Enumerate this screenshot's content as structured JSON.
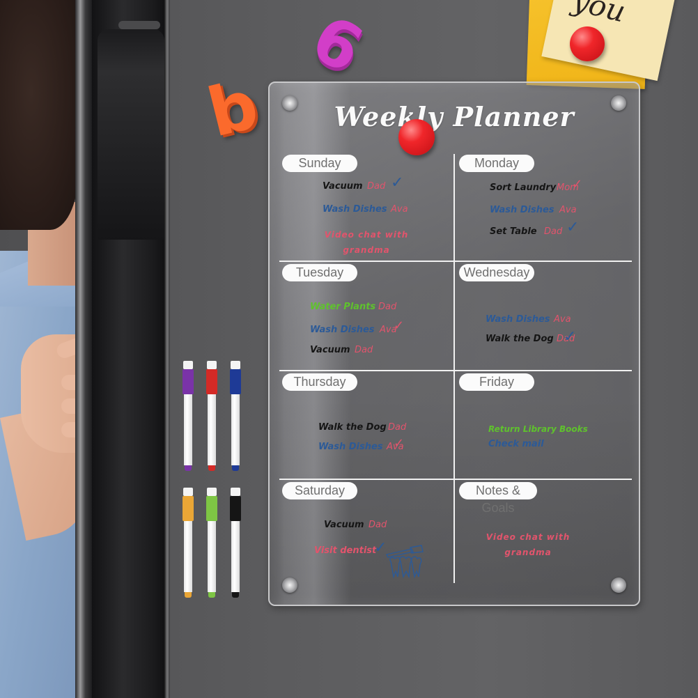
{
  "scene": {
    "description": "Acrylic weekly planner board mounted on a fridge door",
    "colors": {
      "fridge_gray": "#5f5f61",
      "board_border": "#c9c9cb",
      "pill_bg": "#fbfbfb",
      "pill_text": "#707070",
      "ink_black": "#151515",
      "ink_blue": "#2c5a97",
      "ink_green": "#5fc22d",
      "ink_red": "#e2546c",
      "magnet_orange": "#fb6a2c",
      "magnet_pink": "#d23ec8",
      "pin_red": "#f0262a"
    }
  },
  "magnets": {
    "letter_b": "b",
    "number_6": "6"
  },
  "sticky_note": {
    "text": "you"
  },
  "markers": {
    "colors": [
      "purple",
      "red",
      "blue",
      "orange",
      "green",
      "black"
    ],
    "hex": [
      "#7a33a8",
      "#d42a26",
      "#1e3a96",
      "#eaa636",
      "#7ec544",
      "#151515"
    ]
  },
  "planner": {
    "title": "Weekly Planner",
    "days": [
      {
        "label": "Sunday",
        "tasks": [
          {
            "task": "Vacuum",
            "who": "Dad",
            "ink": "black",
            "done": true,
            "check_ink": "blue"
          },
          {
            "task": "Wash Dishes",
            "who": "Ava",
            "ink": "blue",
            "done": false
          },
          {
            "task": "Video chat with grandma",
            "who": "",
            "ink": "red",
            "done": false
          }
        ]
      },
      {
        "label": "Monday",
        "tasks": [
          {
            "task": "Sort Laundry",
            "who": "Mom",
            "ink": "black",
            "done": true,
            "check_ink": "red"
          },
          {
            "task": "Wash Dishes",
            "who": "Ava",
            "ink": "blue",
            "done": false
          },
          {
            "task": "Set Table",
            "who": "Dad",
            "ink": "black",
            "done": true,
            "check_ink": "blue"
          }
        ]
      },
      {
        "label": "Tuesday",
        "tasks": [
          {
            "task": "Water Plants",
            "who": "Dad",
            "ink": "green",
            "done": false
          },
          {
            "task": "Wash Dishes",
            "who": "Ava",
            "ink": "blue",
            "done": true,
            "check_ink": "red"
          },
          {
            "task": "Vacuum",
            "who": "Dad",
            "ink": "black",
            "done": false
          }
        ]
      },
      {
        "label": "Wednesday",
        "tasks": [
          {
            "task": "Wash Dishes",
            "who": "Ava",
            "ink": "blue",
            "done": false
          },
          {
            "task": "Walk the Dog",
            "who": "Dad",
            "ink": "black",
            "done": true,
            "check_ink": "blue"
          }
        ]
      },
      {
        "label": "Thursday",
        "tasks": [
          {
            "task": "Walk the Dog",
            "who": "Dad",
            "ink": "black",
            "done": false
          },
          {
            "task": "Wash Dishes",
            "who": "Ava",
            "ink": "blue",
            "done": true,
            "check_ink": "red"
          }
        ]
      },
      {
        "label": "Friday",
        "tasks": [
          {
            "task": "Return Library Books",
            "who": "",
            "ink": "green",
            "done": false
          },
          {
            "task": "Check mail",
            "who": "",
            "ink": "blue",
            "done": false
          }
        ]
      },
      {
        "label": "Saturday",
        "tasks": [
          {
            "task": "Vacuum",
            "who": "Dad",
            "ink": "black",
            "done": false
          },
          {
            "task": "Visit dentist",
            "who": "",
            "ink": "red",
            "done": true,
            "check_ink": "blue"
          }
        ],
        "doodle": "tooth-and-toothbrush"
      },
      {
        "label": "Notes & Goals",
        "note_line1": "Video chat with",
        "note_line2": "grandma"
      }
    ],
    "sunday_note_line1": "Video chat with",
    "sunday_note_line2": "grandma",
    "check_glyph": "✓"
  }
}
